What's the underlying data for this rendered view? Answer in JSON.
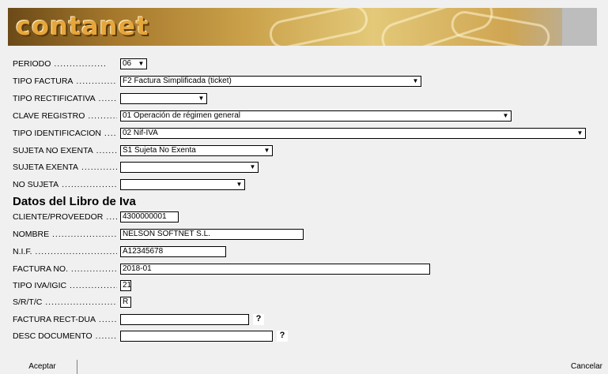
{
  "logo": "contanet",
  "form": {
    "periodo": {
      "label": "PERIODO",
      "value": "06"
    },
    "tipo_factura": {
      "label": "TIPO FACTURA",
      "value": "F2 Factura Simplificada (ticket)"
    },
    "tipo_rectificativa": {
      "label": "TIPO RECTIFICATIVA",
      "value": ""
    },
    "clave_registro": {
      "label": "CLAVE REGISTRO",
      "value": "01 Operación de régimen general"
    },
    "tipo_identificacion": {
      "label": "TIPO IDENTIFICACION",
      "value": "02 Nif-IVA"
    },
    "sujeta_no_exenta": {
      "label": "SUJETA NO EXENTA",
      "value": "S1 Sujeta No Exenta"
    },
    "sujeta_exenta": {
      "label": "SUJETA EXENTA",
      "value": ""
    },
    "no_sujeta": {
      "label": "NO SUJETA",
      "value": ""
    }
  },
  "libro": {
    "title": "Datos del Libro de Iva",
    "cliente": {
      "label": "CLIENTE/PROVEEDOR",
      "value": "4300000001"
    },
    "nombre": {
      "label": "NOMBRE",
      "value": "NELSON SOFTNET S.L."
    },
    "nif": {
      "label": "N.I.F.",
      "value": "A12345678"
    },
    "factura_no": {
      "label": "FACTURA NO.",
      "value": "2018-01"
    },
    "tipo_iva": {
      "label": "TIPO IVA/IGIC",
      "value": "21"
    },
    "srtc": {
      "label": "S/R/T/C",
      "value": "R"
    },
    "factura_rect": {
      "label": "FACTURA RECT-DUA",
      "value": ""
    },
    "desc_documento": {
      "label": "DESC DOCUMENTO",
      "value": ""
    }
  },
  "buttons": {
    "accept": "Aceptar",
    "cancel": "Cancelar",
    "help": "?"
  }
}
